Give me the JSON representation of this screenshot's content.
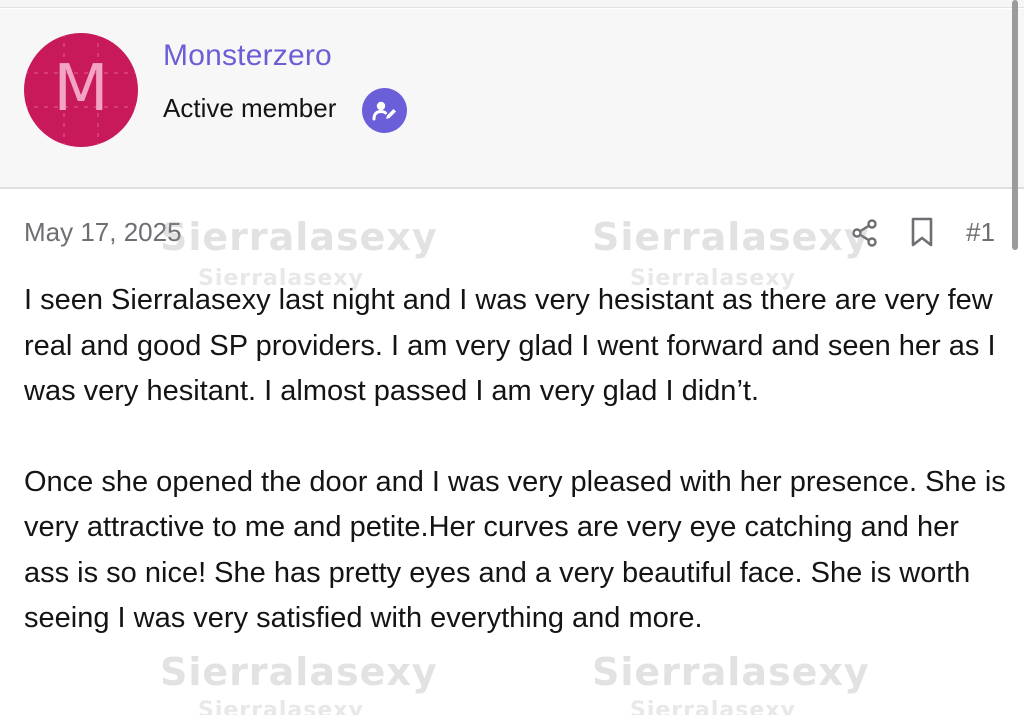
{
  "user": {
    "avatar_letter": "M",
    "avatar_color": "#c8195a",
    "username": "Monsterzero",
    "title": "Active member",
    "badge_icon": "verified-pencil-icon",
    "accent_color": "#6b5fd6"
  },
  "post": {
    "date": "May 17, 2025",
    "number": "#1",
    "share_icon": "share-icon",
    "bookmark_icon": "bookmark-icon",
    "paragraphs": [
      "I seen Sierralasexy last night and I was very hesistant as there are very few real and good SP providers. I am very glad I went forward and seen her as I was very hesitant. I almost passed I am very glad I didn’t.",
      "Once she opened the door and I was very pleased with her presence. She is very attractive to me and petite.Her curves are very eye catching and her ass is so nice! She has pretty eyes and a very beautiful face. She is worth seeing I was very satisfied with everything and more."
    ]
  },
  "watermarks": {
    "text": "Sierralasexy"
  }
}
